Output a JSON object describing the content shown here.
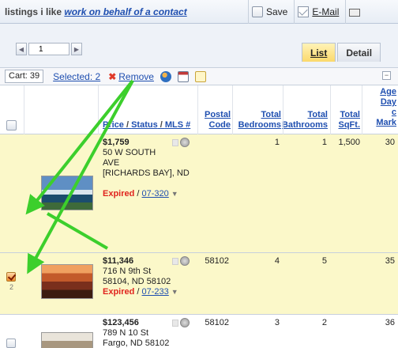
{
  "header": {
    "title_prefix": "listings i like",
    "title_link": "work on behalf of a contact",
    "save_label": "Save",
    "email_label": "E-Mail",
    "print_label": ""
  },
  "pager": {
    "prev": "◀",
    "page_value": "1",
    "next": "▶"
  },
  "tabs": [
    {
      "label": "List",
      "active": true
    },
    {
      "label": "Detail",
      "active": false
    }
  ],
  "toolbar": {
    "cart_label": "Cart: 39",
    "selected_label": "Selected: 2",
    "remove_label": "Remove",
    "collapse_label": "−"
  },
  "columns": {
    "price": "Price",
    "sep1": " / ",
    "status": "Status",
    "sep2": " / ",
    "mls": "MLS #",
    "postal_1": "Postal",
    "postal_2": "Code",
    "beds_1": "Total",
    "beds_2": "Bedrooms",
    "baths_1": "Total",
    "baths_2": "Bathrooms",
    "sqft_1": "Total",
    "sqft_2": "SqFt.",
    "age_1": "Age",
    "age_2": "Day",
    "age_3": "c",
    "age_4": "Mark"
  },
  "rows": [
    {
      "num": "1",
      "checked": true,
      "price": "$1,759",
      "addr1": "50 W SOUTH",
      "addr2": "AVE",
      "addr3": "[RICHARDS BAY], ND",
      "status": "Expired",
      "status_sep": " / ",
      "mls": "07-320",
      "postal": "",
      "beds": "1",
      "baths": "1",
      "sqft": "1,500",
      "age": "30"
    },
    {
      "num": "2",
      "checked": true,
      "price": "$11,346",
      "addr1": "716 N 9th St",
      "addr2": "58104, ND 58102",
      "status": "Expired",
      "status_sep": " / ",
      "mls": "07-233",
      "postal": "58102",
      "beds": "4",
      "baths": "5",
      "sqft": "",
      "age": "35"
    },
    {
      "num": "",
      "checked": false,
      "price": "$123,456",
      "addr1": "789 N 10 St",
      "addr2": "Fargo, ND 58102",
      "postal": "58102",
      "beds": "3",
      "baths": "2",
      "sqft": "",
      "age": "36"
    }
  ],
  "colors": {
    "accent": "#1f4fb0",
    "highlight_row": "#fbf8c9",
    "expired": "#e0241e",
    "arrow": "#3ccf2c",
    "active_tab": "#fbd96b"
  }
}
